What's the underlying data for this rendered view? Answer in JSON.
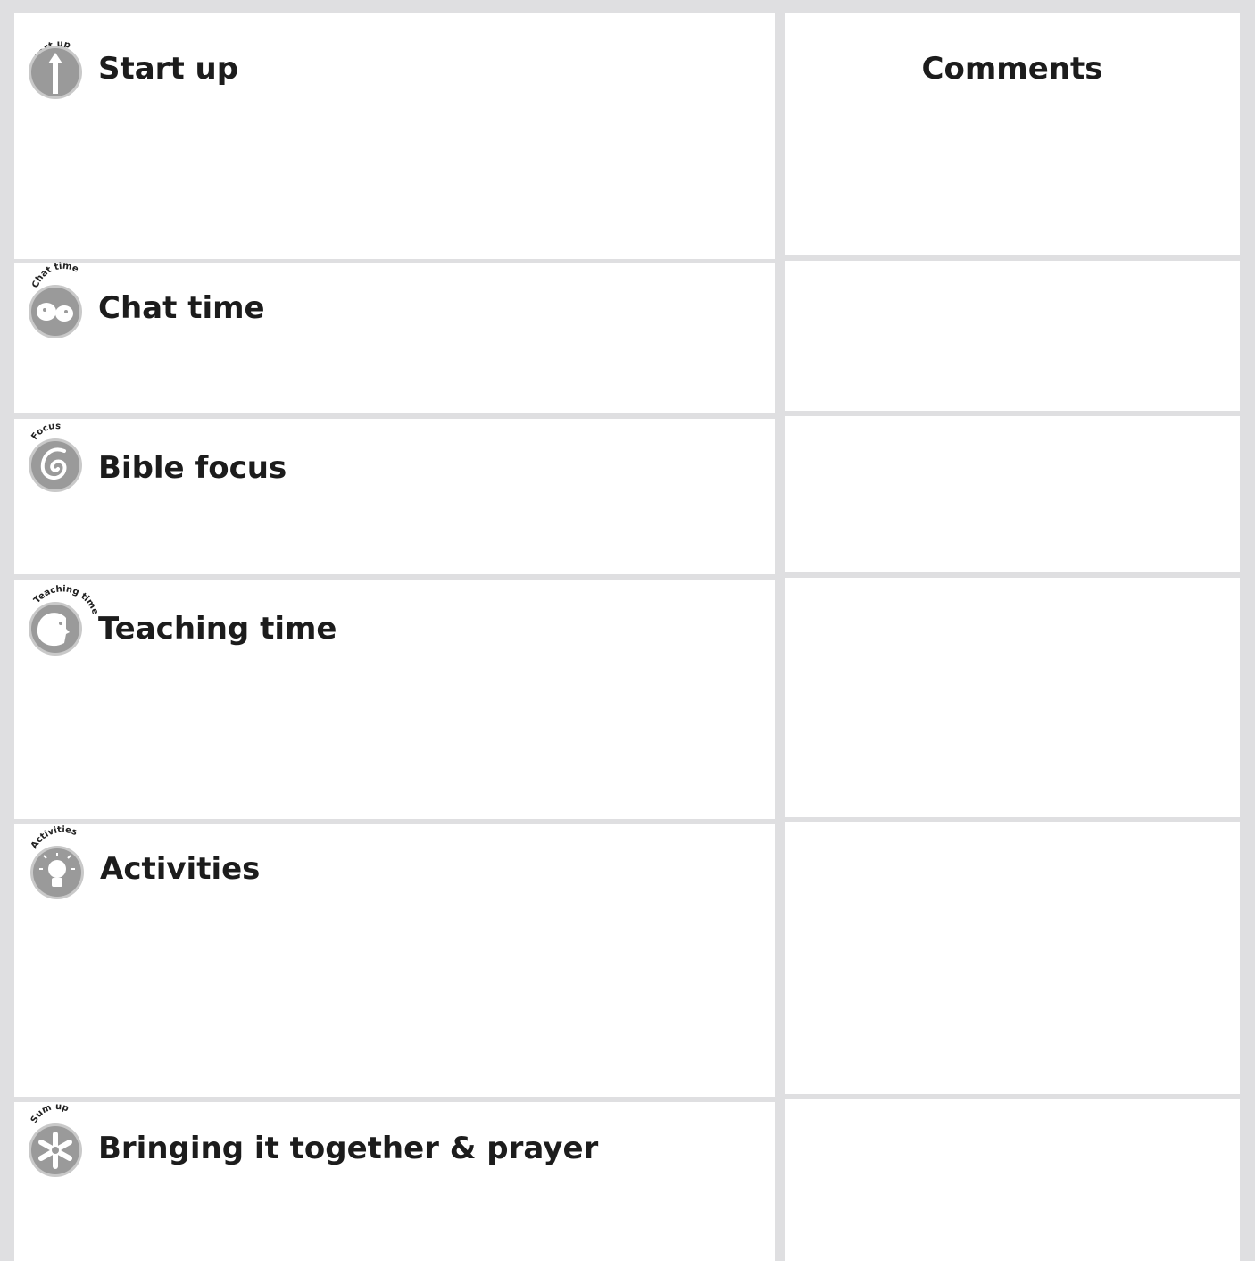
{
  "sections": [
    {
      "title": "Start up",
      "badge_text": "Start up",
      "icon": "up-arrow-icon"
    },
    {
      "title": "Chat time",
      "badge_text": "Chat time",
      "icon": "chat-faces-icon"
    },
    {
      "title": "Bible focus",
      "badge_text": "Focus",
      "icon": "spiral-icon"
    },
    {
      "title": "Teaching time",
      "badge_text": "Teaching time",
      "icon": "face-profile-icon"
    },
    {
      "title": "Activities",
      "badge_text": "Activities",
      "icon": "lightbulb-icon"
    },
    {
      "title": "Bringing it together & prayer",
      "badge_text": "Sum up",
      "icon": "asterisk-icon"
    }
  ],
  "comments_header": "Comments",
  "colors": {
    "frame": "#dfdfe1",
    "cell": "#ffffff",
    "badge_fill": "#9a9a9a",
    "badge_ring": "#c9c9c9",
    "text": "#1c1c1c"
  }
}
